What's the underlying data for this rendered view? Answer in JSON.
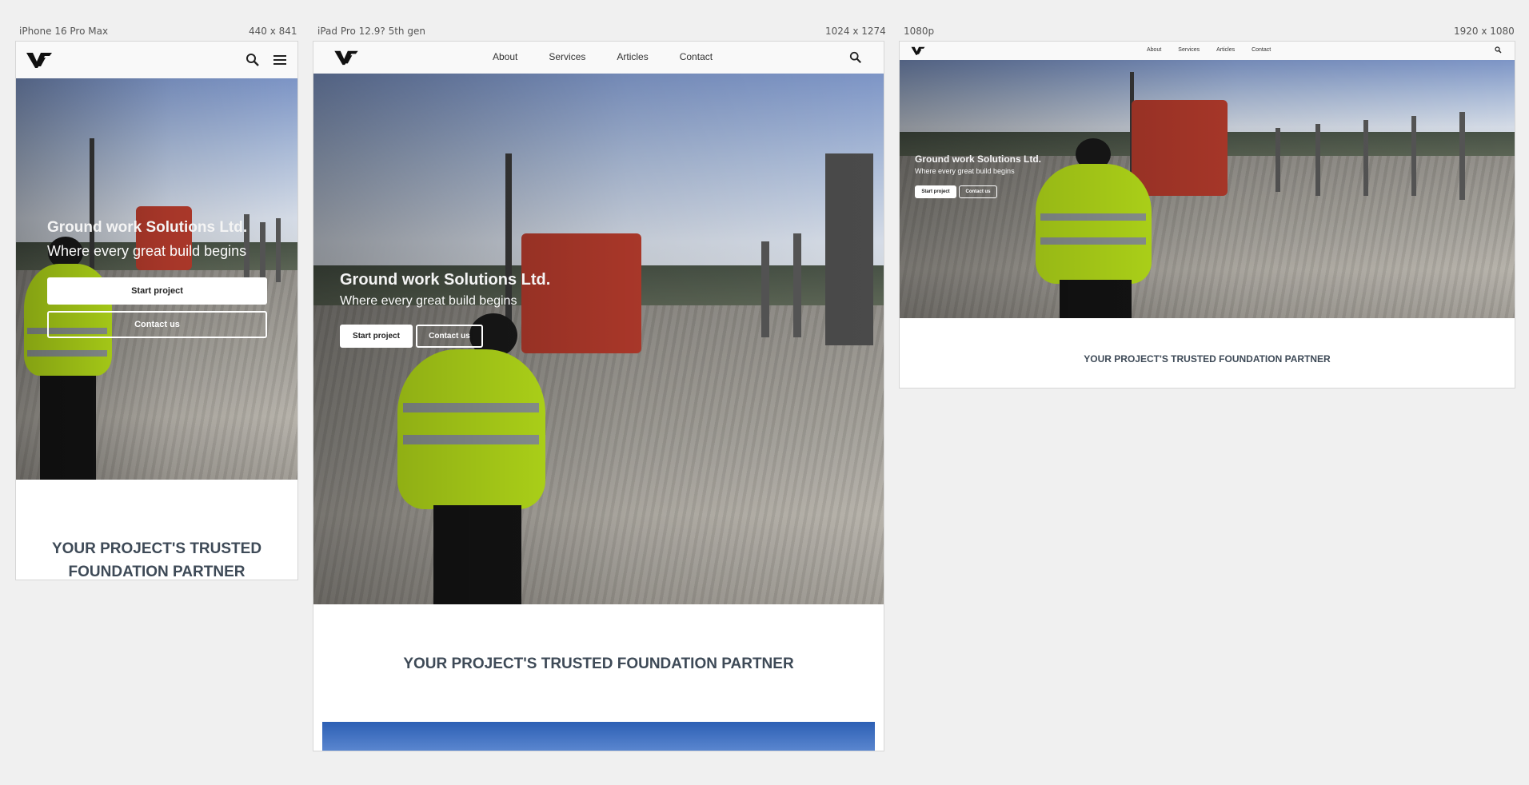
{
  "frames": [
    {
      "device": "iPhone 16 Pro Max",
      "size": "440 x 841"
    },
    {
      "device": "iPad Pro 12.9? 5th gen",
      "size": "1024 x 1274"
    },
    {
      "device": "1080p",
      "size": "1920 x 1080"
    }
  ],
  "nav": {
    "about": "About",
    "services": "Services",
    "articles": "Articles",
    "contact": "Contact"
  },
  "hero": {
    "title": "Ground work Solutions Ltd.",
    "subtitle": "Where every great build begins",
    "primary_cta": "Start project",
    "secondary_cta": "Contact us"
  },
  "tagline": "YOUR PROJECT'S TRUSTED FOUNDATION PARTNER",
  "tagline_mobile_line1": "YOUR PROJECT'S TRUSTED",
  "tagline_mobile_line2": "FOUNDATION PARTNER",
  "icons": {
    "logo": "gmt-logo",
    "search": "search-icon",
    "menu": "hamburger-menu-icon"
  },
  "colors": {
    "page_bg": "#f0f0f0",
    "tagline": "#3e4a57",
    "vest": "#c7f21c",
    "excavator": "#b53b2c"
  }
}
